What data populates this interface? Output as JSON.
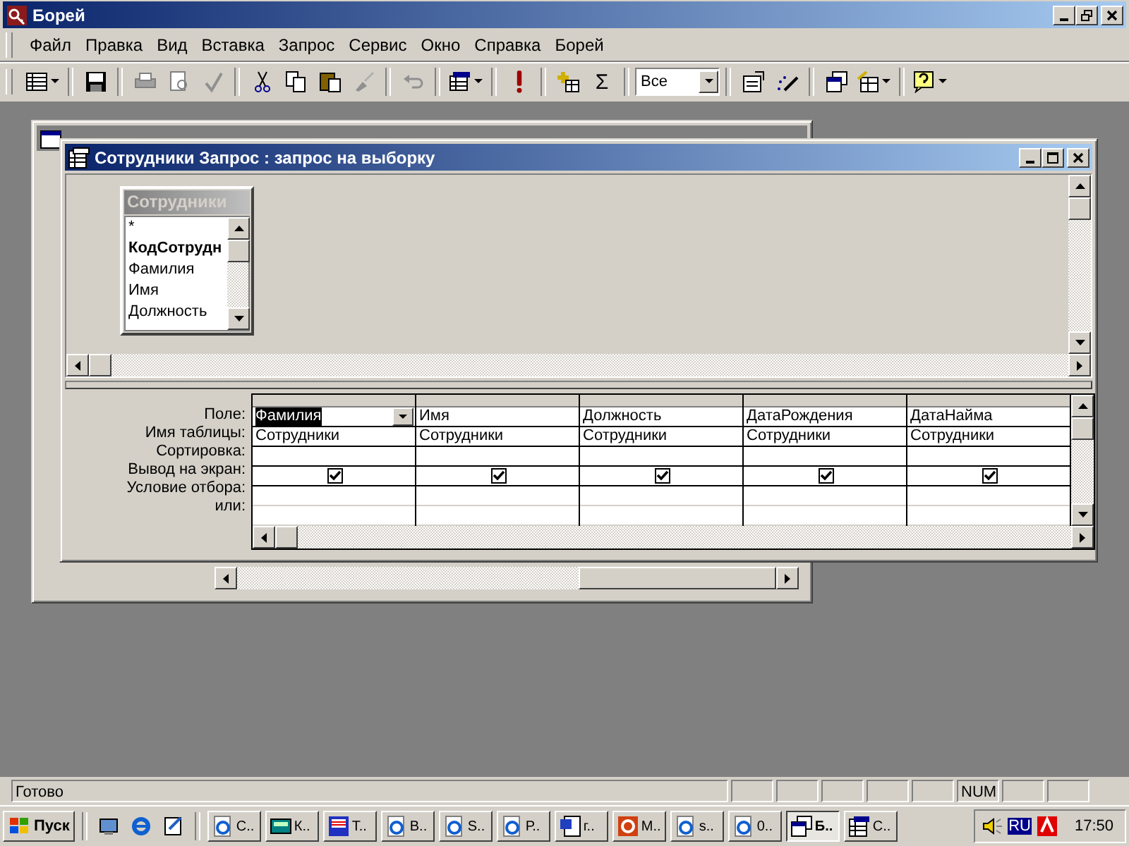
{
  "window": {
    "title": "Борей"
  },
  "menu": [
    "Файл",
    "Правка",
    "Вид",
    "Вставка",
    "Запрос",
    "Сервис",
    "Окно",
    "Справка",
    "Борей"
  ],
  "toolbar": {
    "totals_label": "Σ",
    "filter_value": "Все"
  },
  "query_window": {
    "title": "Сотрудники Запрос : запрос на выборку",
    "table_list": {
      "title": "Сотрудники",
      "fields": [
        {
          "name": "*",
          "bold": false
        },
        {
          "name": "КодСотрудн",
          "bold": true
        },
        {
          "name": "Фамилия",
          "bold": false
        },
        {
          "name": "Имя",
          "bold": false
        },
        {
          "name": "Должность",
          "bold": false
        }
      ]
    },
    "row_labels": [
      "Поле:",
      "Имя таблицы:",
      "Сортировка:",
      "Вывод на экран:",
      "Условие отбора:",
      "или:"
    ],
    "columns": [
      {
        "field": "Фамилия",
        "table": "Сотрудники",
        "show": true,
        "selected": true
      },
      {
        "field": "Имя",
        "table": "Сотрудники",
        "show": true,
        "selected": false
      },
      {
        "field": "Должность",
        "table": "Сотрудники",
        "show": true,
        "selected": false
      },
      {
        "field": "ДатаРождения",
        "table": "Сотрудники",
        "show": true,
        "selected": false
      },
      {
        "field": "ДатаНайма",
        "table": "Сотрудники",
        "show": true,
        "selected": false
      }
    ]
  },
  "status_bar": {
    "text": "Готово",
    "num_indicator": "NUM"
  },
  "taskbar": {
    "start": "Пуск",
    "tasks": [
      {
        "label": "С..",
        "kind": "web",
        "selected": false
      },
      {
        "label": "К..",
        "kind": "calculator",
        "selected": false
      },
      {
        "label": "Т..",
        "kind": "floppy",
        "selected": false
      },
      {
        "label": "В..",
        "kind": "web",
        "selected": false
      },
      {
        "label": "S..",
        "kind": "web",
        "selected": false
      },
      {
        "label": "Р..",
        "kind": "web",
        "selected": false
      },
      {
        "label": "г..",
        "kind": "document",
        "selected": false
      },
      {
        "label": "М..",
        "kind": "presentation",
        "selected": false
      },
      {
        "label": "s..",
        "kind": "web",
        "selected": false
      },
      {
        "label": "0..",
        "kind": "web",
        "selected": false
      },
      {
        "label": "Б..",
        "kind": "database",
        "selected": true
      },
      {
        "label": "С..",
        "kind": "query",
        "selected": false
      }
    ],
    "language": "RU",
    "time": "17:50"
  }
}
